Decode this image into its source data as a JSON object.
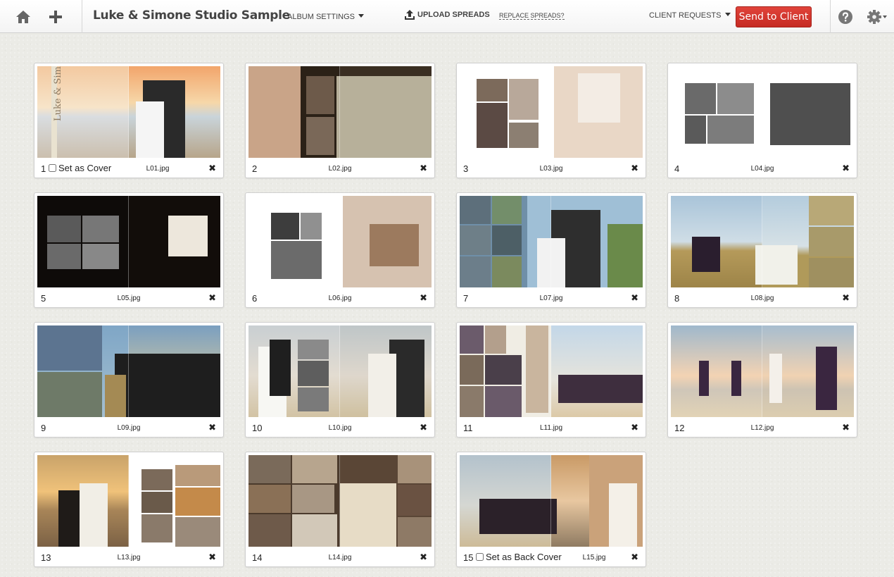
{
  "header": {
    "album_title": "Luke & Simone Studio Sample",
    "album_settings_label": "ALBUM SETTINGS",
    "upload_label": "UPLOAD SPREADS",
    "replace_label": "REPLACE SPREADS?",
    "client_requests_label": "CLIENT REQUESTS",
    "send_label": "Send to Client",
    "icons": [
      "home-icon",
      "plus-icon",
      "upload-icon",
      "help-icon",
      "gear-icon"
    ],
    "accent_color": "#d5362e"
  },
  "cover_label": "Set as Cover",
  "back_cover_label": "Set as Back Cover",
  "cover_text": "Luke & Simone",
  "spreads": [
    {
      "num": "1",
      "file": "L01.jpg"
    },
    {
      "num": "2",
      "file": "L02.jpg"
    },
    {
      "num": "3",
      "file": "L03.jpg"
    },
    {
      "num": "4",
      "file": "L04.jpg"
    },
    {
      "num": "5",
      "file": "L05.jpg"
    },
    {
      "num": "6",
      "file": "L06.jpg"
    },
    {
      "num": "7",
      "file": "L07.jpg"
    },
    {
      "num": "8",
      "file": "L08.jpg"
    },
    {
      "num": "9",
      "file": "L09.jpg"
    },
    {
      "num": "10",
      "file": "L10.jpg"
    },
    {
      "num": "11",
      "file": "L11.jpg"
    },
    {
      "num": "12",
      "file": "L12.jpg"
    },
    {
      "num": "13",
      "file": "L13.jpg"
    },
    {
      "num": "14",
      "file": "L14.jpg"
    },
    {
      "num": "15",
      "file": "L15.jpg"
    }
  ]
}
